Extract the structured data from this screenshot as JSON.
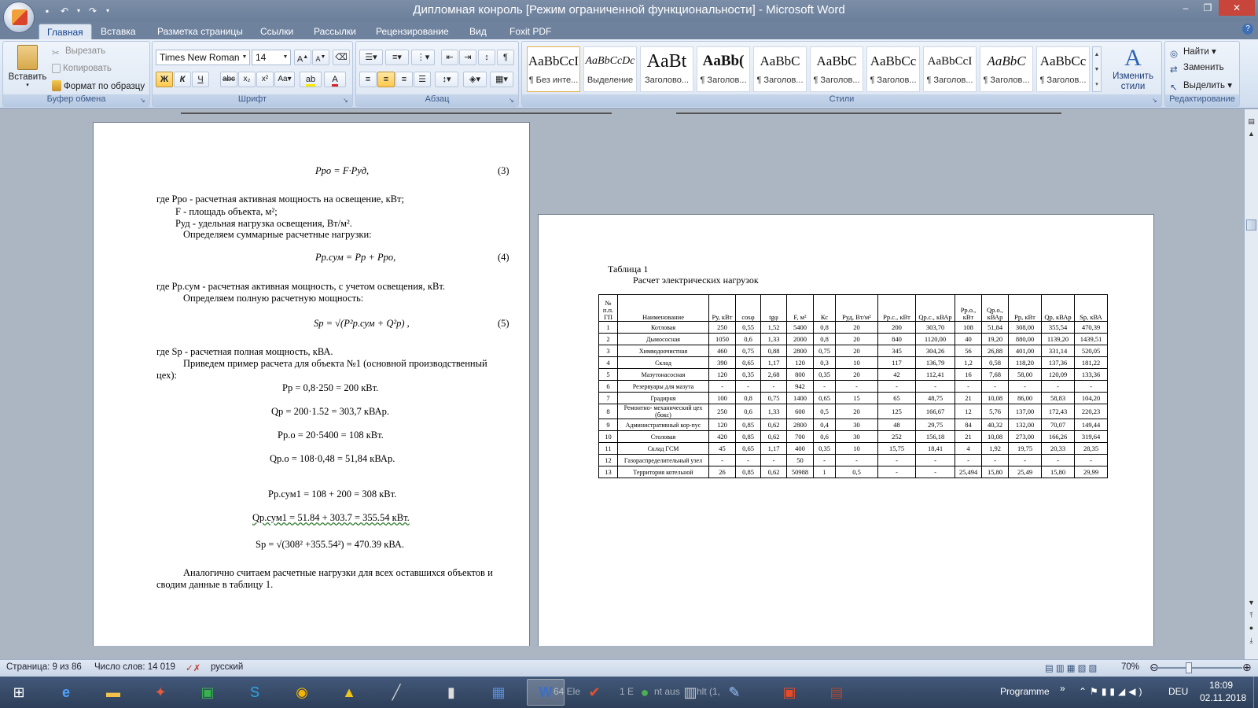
{
  "window": {
    "title": "Дипломная конроль [Режим ограниченной функциональности] - Microsoft Word",
    "minimize": "–",
    "maximize": "❐",
    "close": "✕"
  },
  "tabs": [
    "Главная",
    "Вставка",
    "Разметка страницы",
    "Ссылки",
    "Рассылки",
    "Рецензирование",
    "Вид",
    "Foxit PDF"
  ],
  "ribbon": {
    "clipboard": {
      "label": "Буфер обмена",
      "paste": "Вставить",
      "cut": "Вырезать",
      "copy": "Копировать",
      "format_painter": "Формат по образцу"
    },
    "font": {
      "label": "Шрифт",
      "family": "Times New Roman",
      "size": "14"
    },
    "paragraph": {
      "label": "Абзац"
    },
    "styles": {
      "label": "Стили",
      "items": [
        {
          "sample": "AaBbCcI",
          "name": "¶ Без инте..."
        },
        {
          "sample": "AaBbCcDc",
          "name": "Выделение"
        },
        {
          "sample": "AaBt",
          "name": "Заголово..."
        },
        {
          "sample": "AaBb(",
          "name": "¶ Заголов..."
        },
        {
          "sample": "AaBbC",
          "name": "¶ Заголов..."
        },
        {
          "sample": "AaBbC",
          "name": "¶ Заголов..."
        },
        {
          "sample": "AaBbCc",
          "name": "¶ Заголов..."
        },
        {
          "sample": "AaBbCcI",
          "name": "¶ Заголов..."
        },
        {
          "sample": "AaBbC",
          "name": "¶ Заголов..."
        },
        {
          "sample": "AaBbCc",
          "name": "¶ Заголов..."
        }
      ],
      "change_styles": "Изменить стили"
    },
    "editing": {
      "label": "Редактирование",
      "find": "Найти",
      "replace": "Заменить",
      "select": "Выделить"
    }
  },
  "page1": {
    "eq3": "Pро = F·Pуд,",
    "eq3_num": "(3)",
    "line1": "где  Pро - расчетная активная мощность на освещение, кВт;",
    "line2": "F   - площадь объекта, м²;",
    "line3": "Pуд - удельная нагрузка освещения, Вт/м².",
    "line4": "Определяем суммарные расчетные нагрузки:",
    "eq4": "Pр.сум = Pр + Pро,",
    "eq4_num": "(4)",
    "line5": "где Pр.сум - расчетная активная мощность, с учетом освещения, кВт.",
    "line6": "Определяем полную расчетную мощность:",
    "eq5": "Sр = √(P²р.сум + Q²р) ,",
    "eq5_num": "(5)",
    "line7": "где  Sр - расчетная полная мощность, кВА.",
    "line8": "Приведем пример расчета для объекта №1 (основной производственный",
    "line9": "цех):",
    "calc1": "Pр = 0,8·250 = 200 кВт.",
    "calc2": "Qр = 200·1.52 = 303,7 кВАр.",
    "calc3": "Pр.о = 20·5400 = 108 кВт.",
    "calc4": "Qр.о = 108·0,48 = 51,84 кВАр.",
    "calc5": "Pр.сум1 = 108 + 200 = 308  кВт.",
    "calc6": "Qр.сум1 = 51.84 + 303.7 = 355.54  кВт.",
    "calc7": "Sр = √(308² +355.54²) = 470.39 кВА.",
    "line10": "Аналогично считаем расчетные нагрузки для всех оставшихся объектов и",
    "line11": "сводим данные в таблицу 1."
  },
  "page2": {
    "table_title": "Таблица 1",
    "table_subtitle": "Расчет электрических нагрузок",
    "headers": [
      "№ п.п. ГП",
      "Наименование",
      "Ру, кВт",
      "cosφ",
      "tgφ",
      "F, м²",
      "Кс",
      "Руд, Вт/м²",
      "Рр.с., кВт",
      "Qр.с., кВАр",
      "Рр.о., кВт",
      "Qр.о., кВАр",
      "Рр, кВт",
      "Qр, кВАр",
      "Sр, кВА"
    ],
    "rows": [
      [
        "1",
        "Котловая",
        "250",
        "0,55",
        "1,52",
        "5400",
        "0,8",
        "20",
        "200",
        "303,70",
        "108",
        "51,84",
        "308,00",
        "355,54",
        "470,39"
      ],
      [
        "2",
        "Дымососная",
        "1050",
        "0,6",
        "1,33",
        "2000",
        "0,8",
        "20",
        "840",
        "1120,00",
        "40",
        "19,20",
        "880,00",
        "1139,20",
        "1439,51"
      ],
      [
        "3",
        "Химводоочистная",
        "460",
        "0,75",
        "0,88",
        "2800",
        "0,75",
        "20",
        "345",
        "304,26",
        "56",
        "26,88",
        "401,00",
        "331,14",
        "520,05"
      ],
      [
        "4",
        "Склад",
        "390",
        "0,65",
        "1,17",
        "120",
        "0,3",
        "10",
        "117",
        "136,79",
        "1,2",
        "0,58",
        "118,20",
        "137,36",
        "181,22"
      ],
      [
        "5",
        "Мазутонасосная",
        "120",
        "0,35",
        "2,68",
        "800",
        "0,35",
        "20",
        "42",
        "112,41",
        "16",
        "7,68",
        "58,00",
        "120,09",
        "133,36"
      ],
      [
        "6",
        "Резервуары для мазута",
        "-",
        "-",
        "-",
        "942",
        "-",
        "-",
        "-",
        "-",
        "-",
        "-",
        "-",
        "-",
        "-"
      ],
      [
        "7",
        "Градирня",
        "100",
        "0,8",
        "0,75",
        "1400",
        "0,65",
        "15",
        "65",
        "48,75",
        "21",
        "10,08",
        "86,00",
        "58,83",
        "104,20"
      ],
      [
        "8",
        "Ремонтно- механический цех (бокс)",
        "250",
        "0,6",
        "1,33",
        "600",
        "0,5",
        "20",
        "125",
        "166,67",
        "12",
        "5,76",
        "137,00",
        "172,43",
        "220,23"
      ],
      [
        "9",
        "Административный кор-пус",
        "120",
        "0,85",
        "0,62",
        "2800",
        "0,4",
        "30",
        "48",
        "29,75",
        "84",
        "40,32",
        "132,00",
        "70,07",
        "149,44"
      ],
      [
        "10",
        "Столовая",
        "420",
        "0,85",
        "0,62",
        "700",
        "0,6",
        "30",
        "252",
        "156,18",
        "21",
        "10,08",
        "273,00",
        "166,26",
        "319,64"
      ],
      [
        "11",
        "Склад ГСМ",
        "45",
        "0,65",
        "1,17",
        "400",
        "0,35",
        "10",
        "15,75",
        "18,41",
        "4",
        "1,92",
        "19,75",
        "20,33",
        "28,35"
      ],
      [
        "12",
        "Газораспределительный узел",
        "-",
        "-",
        "-",
        "50",
        "-",
        "-",
        "-",
        "-",
        "-",
        "-",
        "-",
        "-",
        "-"
      ],
      [
        "13",
        "Территория котельной",
        "26",
        "0,85",
        "0,62",
        "50988",
        "1",
        "0,5",
        "-",
        "-",
        "25,494",
        "15,80",
        "25,49",
        "15,80",
        "29,99"
      ]
    ]
  },
  "status": {
    "page": "Страница: 9 из 86",
    "words": "Число слов: 14 019",
    "language": "русский",
    "zoom": "70%"
  },
  "taskbar": {
    "item_text1": "64 Ele",
    "item_text2": "1 E",
    "item_text3": "nt aus",
    "item_text4": "hlt (1,",
    "programme": "Programme",
    "lang": "DEU",
    "time": "18:09",
    "date": "02.11.2018"
  }
}
